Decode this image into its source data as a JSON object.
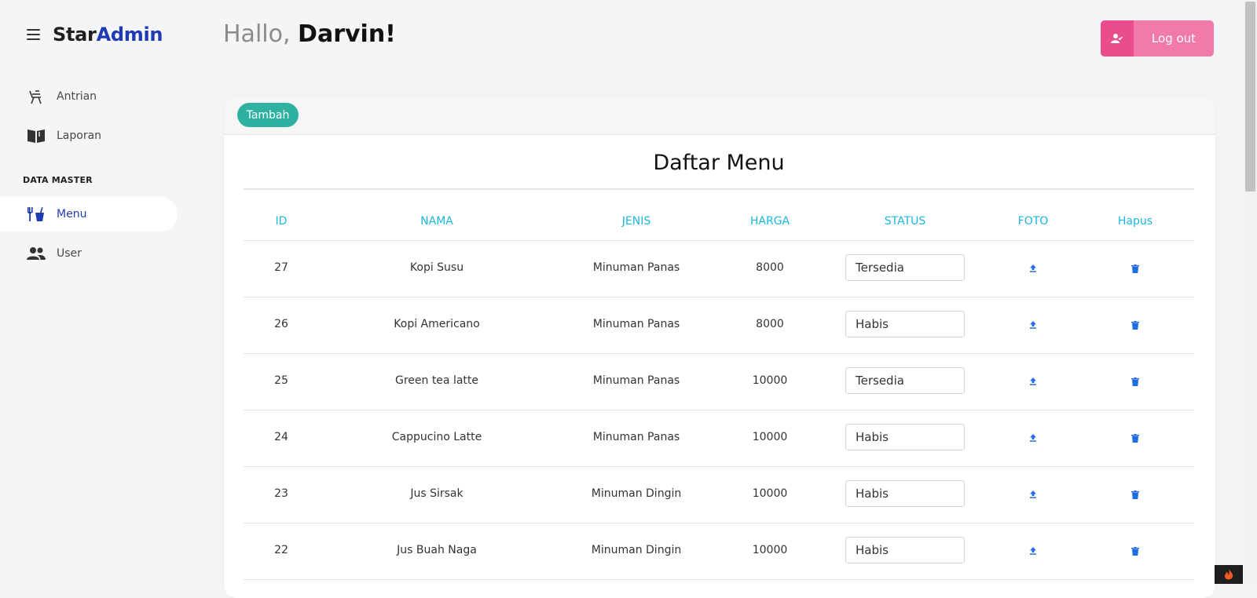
{
  "brand": {
    "part1": "Star",
    "part2": "Admin"
  },
  "sidebar": {
    "items": [
      {
        "label": "Antrian",
        "icon": "chair-icon"
      },
      {
        "label": "Laporan",
        "icon": "book-icon"
      },
      {
        "label": "Menu",
        "icon": "food-menu-icon",
        "active": true
      },
      {
        "label": "User",
        "icon": "users-icon"
      }
    ],
    "section_title": "DATA MASTER"
  },
  "header": {
    "greeting": "Hallo, ",
    "name": "Darvin!",
    "logout_label": "Log out"
  },
  "card": {
    "add_button": "Tambah",
    "title": "Daftar Menu",
    "columns": [
      "ID",
      "NAMA",
      "JENIS",
      "HARGA",
      "STATUS",
      "FOTO",
      "Hapus"
    ],
    "rows": [
      {
        "id": "27",
        "nama": "Kopi Susu",
        "jenis": "Minuman Panas",
        "harga": "8000",
        "status": "Tersedia"
      },
      {
        "id": "26",
        "nama": "Kopi Americano",
        "jenis": "Minuman Panas",
        "harga": "8000",
        "status": "Habis"
      },
      {
        "id": "25",
        "nama": "Green tea latte",
        "jenis": "Minuman Panas",
        "harga": "10000",
        "status": "Tersedia"
      },
      {
        "id": "24",
        "nama": "Cappucino Latte",
        "jenis": "Minuman Panas",
        "harga": "10000",
        "status": "Habis"
      },
      {
        "id": "23",
        "nama": "Jus Sirsak",
        "jenis": "Minuman Dingin",
        "harga": "10000",
        "status": "Habis"
      },
      {
        "id": "22",
        "nama": "Jus Buah Naga",
        "jenis": "Minuman Dingin",
        "harga": "10000",
        "status": "Habis"
      }
    ]
  },
  "colors": {
    "accent": "#1f3bb3",
    "header_text": "#1ab7e0",
    "add_button": "#2fb1a2",
    "logout": "#f17aa8",
    "icon_blue": "#1e6be3"
  }
}
